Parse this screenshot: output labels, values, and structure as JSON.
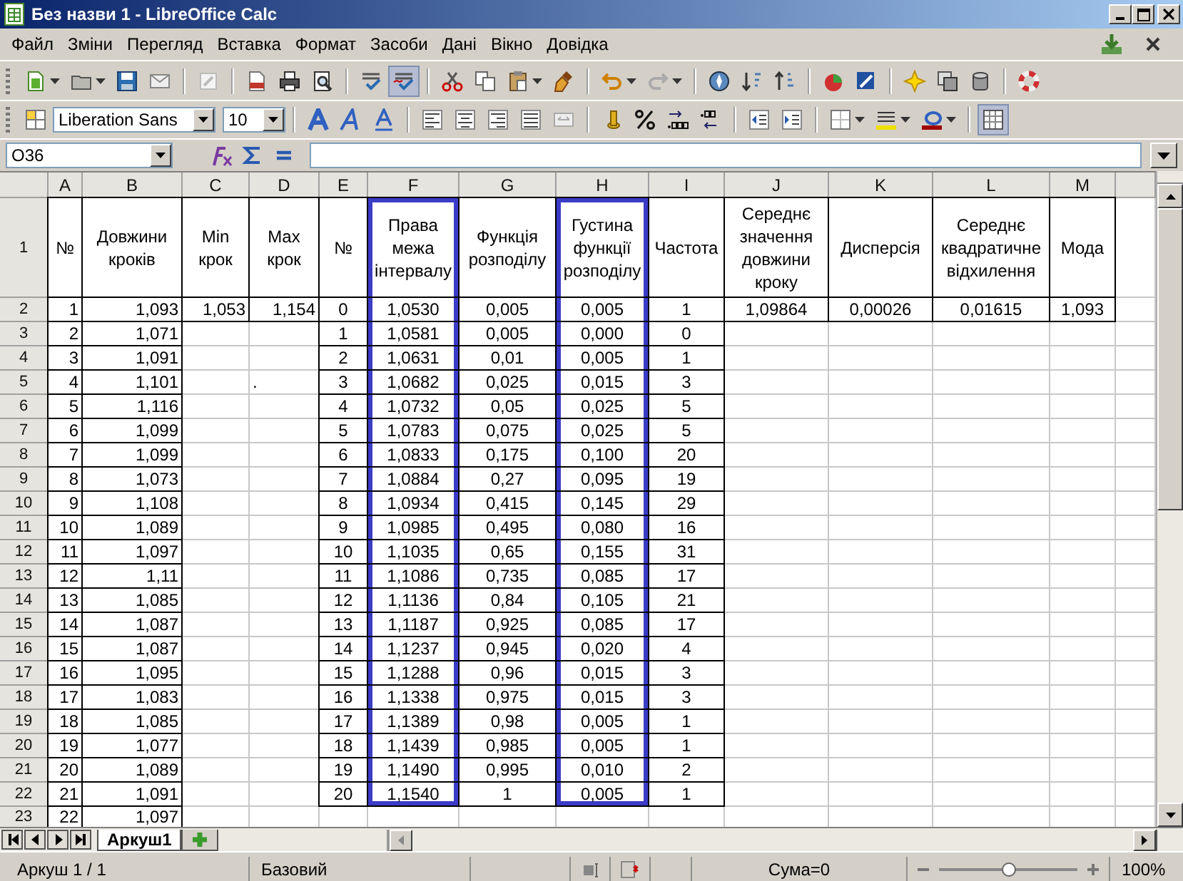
{
  "window": {
    "title": "Без назви 1 - LibreOffice Calc"
  },
  "menu": [
    "Файл",
    "Зміни",
    "Перегляд",
    "Вставка",
    "Формат",
    "Засоби",
    "Дані",
    "Вікно",
    "Довідка"
  ],
  "toolbar": {
    "auto_spellcheck_on": true,
    "font_name": "Liberation Sans",
    "font_size": "10",
    "grid_lines_on": true
  },
  "formula_bar": {
    "name_box": "O36"
  },
  "sheet": {
    "columns": [
      {
        "label": "A",
        "outlined": false
      },
      {
        "label": "B",
        "outlined": false
      },
      {
        "label": "C",
        "outlined": false
      },
      {
        "label": "D",
        "outlined": false
      },
      {
        "label": "E",
        "outlined": false
      },
      {
        "label": "F",
        "outlined": true
      },
      {
        "label": "G",
        "outlined": false
      },
      {
        "label": "H",
        "outlined": true
      },
      {
        "label": "I",
        "outlined": false
      },
      {
        "label": "J",
        "outlined": false
      },
      {
        "label": "K",
        "outlined": false
      },
      {
        "label": "L",
        "outlined": false
      },
      {
        "label": "M",
        "outlined": false
      }
    ],
    "rows": [
      {
        "number": "1",
        "cells": [
          "№",
          "Довжини кроків",
          "Min крок",
          "Max крок",
          "№",
          "Права межа інтервалу",
          "Функція розподілу",
          "Густина функції розподілу",
          "Частота",
          "Середнє значення довжини кроку",
          "Дисперсія",
          "Середнє квадратичне відхилення",
          "Мода"
        ]
      },
      {
        "number": "2",
        "cells": [
          "1",
          "1,093",
          "1,053",
          "1,154",
          "0",
          "1,0530",
          "0,005",
          "0,005",
          "1",
          "1,09864",
          "0,00026",
          "0,01615",
          "1,093"
        ]
      },
      {
        "number": "3",
        "cells": [
          "2",
          "1,071",
          null,
          null,
          "1",
          "1,0581",
          "0,005",
          "0,000",
          "0"
        ]
      },
      {
        "number": "4",
        "cells": [
          "3",
          "1,091",
          null,
          null,
          "2",
          "1,0631",
          "0,01",
          "0,005",
          "1"
        ]
      },
      {
        "number": "5",
        "cells": [
          "4",
          "1,101",
          null,
          {
            "text": ".",
            "plain": true
          },
          "3",
          "1,0682",
          "0,025",
          "0,015",
          "3"
        ]
      },
      {
        "number": "6",
        "cells": [
          "5",
          "1,116",
          null,
          null,
          "4",
          "1,0732",
          "0,05",
          "0,025",
          "5"
        ]
      },
      {
        "number": "7",
        "cells": [
          "6",
          "1,099",
          null,
          null,
          "5",
          "1,0783",
          "0,075",
          "0,025",
          "5"
        ]
      },
      {
        "number": "8",
        "cells": [
          "7",
          "1,099",
          null,
          null,
          "6",
          "1,0833",
          "0,175",
          "0,100",
          "20"
        ]
      },
      {
        "number": "9",
        "cells": [
          "8",
          "1,073",
          null,
          null,
          "7",
          "1,0884",
          "0,27",
          "0,095",
          "19"
        ]
      },
      {
        "number": "10",
        "cells": [
          "9",
          "1,108",
          null,
          null,
          "8",
          "1,0934",
          "0,415",
          "0,145",
          "29"
        ]
      },
      {
        "number": "11",
        "cells": [
          "10",
          "1,089",
          null,
          null,
          "9",
          "1,0985",
          "0,495",
          "0,080",
          "16"
        ]
      },
      {
        "number": "12",
        "cells": [
          "11",
          "1,097",
          null,
          null,
          "10",
          "1,1035",
          "0,65",
          "0,155",
          "31"
        ]
      },
      {
        "number": "13",
        "cells": [
          "12",
          "1,11",
          null,
          null,
          "11",
          "1,1086",
          "0,735",
          "0,085",
          "17"
        ]
      },
      {
        "number": "14",
        "cells": [
          "13",
          "1,085",
          null,
          null,
          "12",
          "1,1136",
          "0,84",
          "0,105",
          "21"
        ]
      },
      {
        "number": "15",
        "cells": [
          "14",
          "1,087",
          null,
          null,
          "13",
          "1,1187",
          "0,925",
          "0,085",
          "17"
        ]
      },
      {
        "number": "16",
        "cells": [
          "15",
          "1,087",
          null,
          null,
          "14",
          "1,1237",
          "0,945",
          "0,020",
          "4"
        ]
      },
      {
        "number": "17",
        "cells": [
          "16",
          "1,095",
          null,
          null,
          "15",
          "1,1288",
          "0,96",
          "0,015",
          "3"
        ]
      },
      {
        "number": "18",
        "cells": [
          "17",
          "1,083",
          null,
          null,
          "16",
          "1,1338",
          "0,975",
          "0,015",
          "3"
        ]
      },
      {
        "number": "19",
        "cells": [
          "18",
          "1,085",
          null,
          null,
          "17",
          "1,1389",
          "0,98",
          "0,005",
          "1"
        ]
      },
      {
        "number": "20",
        "cells": [
          "19",
          "1,077",
          null,
          null,
          "18",
          "1,1439",
          "0,985",
          "0,005",
          "1"
        ]
      },
      {
        "number": "21",
        "cells": [
          "20",
          "1,089",
          null,
          null,
          "19",
          "1,1490",
          "0,995",
          "0,010",
          "2"
        ]
      },
      {
        "number": "22",
        "cells": [
          "21",
          "1,091",
          null,
          null,
          "20",
          "1,1540",
          "1",
          "0,005",
          "1"
        ]
      },
      {
        "number": "23",
        "cells": [
          "22",
          "1,097"
        ]
      }
    ]
  },
  "sheet_tabs": [
    {
      "label": "Аркуш1",
      "selected": true
    }
  ],
  "status_bar": {
    "sheet": "Аркуш 1 / 1",
    "page_style": "Базовий",
    "sum": "Сума=0",
    "zoom": {
      "level": 0.5
    },
    "zoom_percent": "100%"
  }
}
